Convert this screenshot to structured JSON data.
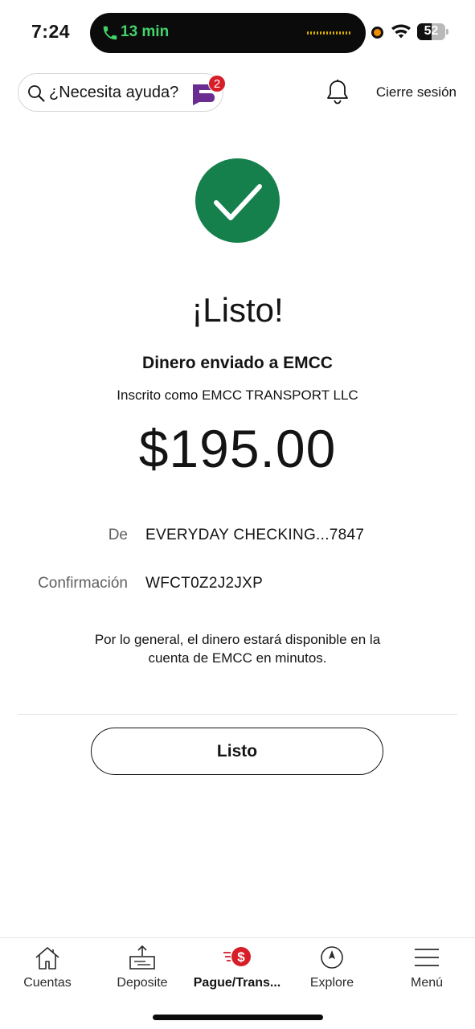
{
  "status_bar": {
    "time": "7:24",
    "call_duration": "13 min",
    "battery_level": "52",
    "battery_percent": 52,
    "icons": [
      "phone-icon",
      "orange-dot-indicator",
      "wifi-icon",
      "battery-icon"
    ]
  },
  "header": {
    "help_text": "¿Necesita ayuda?",
    "assistant_badge_count": "2",
    "logout_label": "Cierre sesión",
    "icons": [
      "search-icon",
      "fargo-assistant-icon",
      "bell-icon"
    ]
  },
  "confirmation": {
    "title": "¡Listo!",
    "subtitle": "Dinero enviado a EMCC",
    "enrolled_as": "Inscrito como EMCC TRANSPORT LLC",
    "amount": "$195.00",
    "details": [
      {
        "label": "De",
        "value": "EVERYDAY CHECKING...7847"
      },
      {
        "label": "Confirmación",
        "value": "WFCT0Z2J2JXP"
      }
    ],
    "note": "Por lo general, el dinero estará disponible en la cuenta de EMCC en minutos.",
    "done_button_label": "Listo"
  },
  "bottom_nav": {
    "items": [
      {
        "label": "Cuentas",
        "icon": "home-icon",
        "active": false
      },
      {
        "label": "Deposite",
        "icon": "deposit-icon",
        "active": false
      },
      {
        "label": "Pague/Trans...",
        "icon": "pay-transfer-icon",
        "active": true
      },
      {
        "label": "Explore",
        "icon": "compass-icon",
        "active": false
      },
      {
        "label": "Menú",
        "icon": "menu-icon",
        "active": false
      }
    ]
  },
  "colors": {
    "success_green": "#16804d",
    "brand_red": "#d71e28",
    "call_green": "#43d36b",
    "assistant_purple": "#6b2c91"
  }
}
